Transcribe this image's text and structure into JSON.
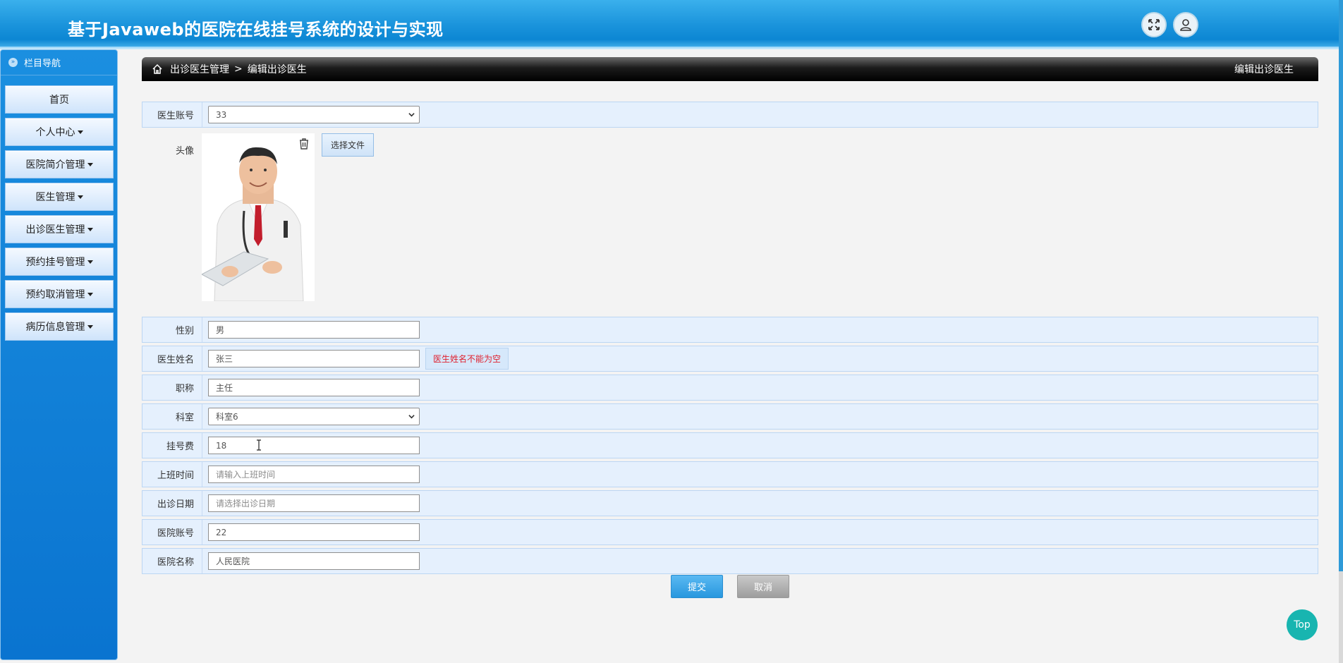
{
  "header": {
    "title": "基于Javaweb的医院在线挂号系统的设计与实现",
    "fullscreen_icon": "expand-icon",
    "user_icon": "user-icon"
  },
  "sidebar": {
    "title": "栏目导航",
    "items": [
      {
        "label": "首页",
        "has_caret": false
      },
      {
        "label": "个人中心",
        "has_caret": true
      },
      {
        "label": "医院简介管理",
        "has_caret": true
      },
      {
        "label": "医生管理",
        "has_caret": true
      },
      {
        "label": "出诊医生管理",
        "has_caret": true
      },
      {
        "label": "预约挂号管理",
        "has_caret": true
      },
      {
        "label": "预约取消管理",
        "has_caret": true
      },
      {
        "label": "病历信息管理",
        "has_caret": true
      }
    ]
  },
  "breadcrumb": {
    "parent": "出诊医生管理",
    "separator": ">",
    "current": "编辑出诊医生",
    "right_title": "编辑出诊医生"
  },
  "form": {
    "doctor_account": {
      "label": "医生账号",
      "value": "33"
    },
    "avatar": {
      "label": "头像",
      "file_button": "选择文件"
    },
    "gender": {
      "label": "性别",
      "value": "男"
    },
    "doctor_name": {
      "label": "医生姓名",
      "value": "张三",
      "error": "医生姓名不能为空"
    },
    "title": {
      "label": "职称",
      "value": "主任"
    },
    "department": {
      "label": "科室",
      "value": "科室6"
    },
    "fee": {
      "label": "挂号费",
      "value": "18"
    },
    "work_time": {
      "label": "上班时间",
      "placeholder": "请输入上班时间"
    },
    "visit_date": {
      "label": "出诊日期",
      "placeholder": "请选择出诊日期"
    },
    "hospital_account": {
      "label": "医院账号",
      "value": "22"
    },
    "hospital_name": {
      "label": "医院名称",
      "value": "人民医院"
    }
  },
  "buttons": {
    "submit": "提交",
    "cancel": "取消",
    "top": "Top"
  },
  "colors": {
    "header": "#1b94dc",
    "sidebar": "#0a74d0",
    "row_bg": "#e5f0fd",
    "error": "#e0212f",
    "submit": "#2897de",
    "top_button": "#18b5b0"
  }
}
